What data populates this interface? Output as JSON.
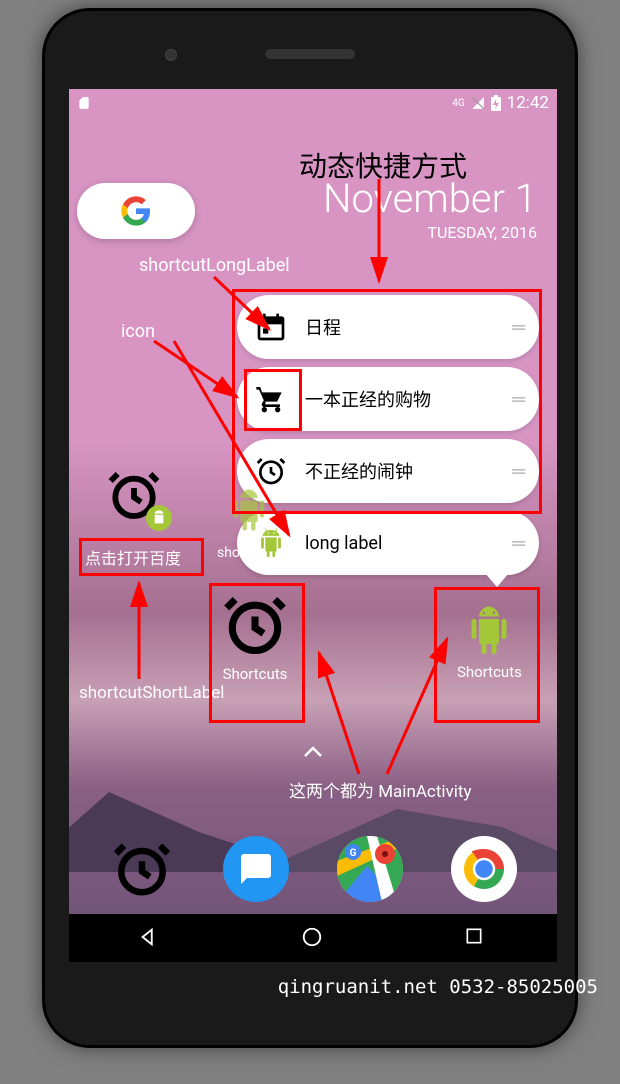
{
  "status_bar": {
    "time": "12:42",
    "net_icon": "4G"
  },
  "heading": "动态快捷方式",
  "date": "November 1",
  "day": "TUESDAY, 2016",
  "annotations": {
    "long_label": "shortcutLongLabel",
    "icon": "icon",
    "short_label": "shortcutShortLabel",
    "main_activity": "这两个都为 MainActivity"
  },
  "shortcuts": [
    {
      "icon": "calendar",
      "label": "日程"
    },
    {
      "icon": "cart",
      "label": "一本正经的购物"
    },
    {
      "icon": "alarm",
      "label": "不正经的闹钟"
    },
    {
      "icon": "android",
      "label": "long label"
    }
  ],
  "home_icons": {
    "baidu_label": "点击打开百度",
    "shortcuts_label": "Shortcuts",
    "sho_prefix": "sho"
  },
  "watermark": "qingruanit.net 0532-85025005"
}
